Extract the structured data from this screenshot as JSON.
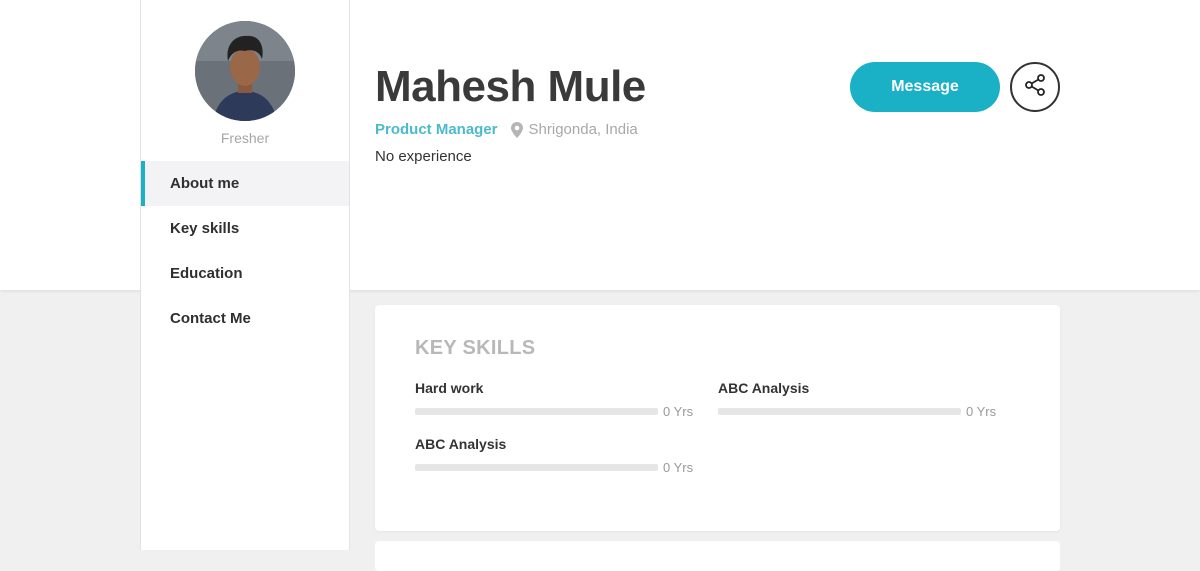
{
  "profile": {
    "name": "Mahesh Mule",
    "role_tag": "Fresher",
    "job_title": "Product Manager",
    "location": "Shrigonda, India",
    "experience": "No experience"
  },
  "actions": {
    "message_label": "Message"
  },
  "nav": {
    "items": [
      {
        "label": "About me",
        "active": true
      },
      {
        "label": "Key skills",
        "active": false
      },
      {
        "label": "Education",
        "active": false
      },
      {
        "label": "Contact Me",
        "active": false
      }
    ]
  },
  "key_skills": {
    "title": "KEY SKILLS",
    "items": [
      {
        "name": "Hard work",
        "years": "0 Yrs",
        "level": 0
      },
      {
        "name": "ABC Analysis",
        "years": "0 Yrs",
        "level": 0
      },
      {
        "name": "ABC Analysis",
        "years": "0 Yrs",
        "level": 0
      }
    ]
  },
  "colors": {
    "accent": "#1ab0c6",
    "job_title": "#4bbbcc",
    "page_bg": "#f0f0f0"
  },
  "icons": {
    "location": "map-pin-icon",
    "share": "share-icon"
  }
}
